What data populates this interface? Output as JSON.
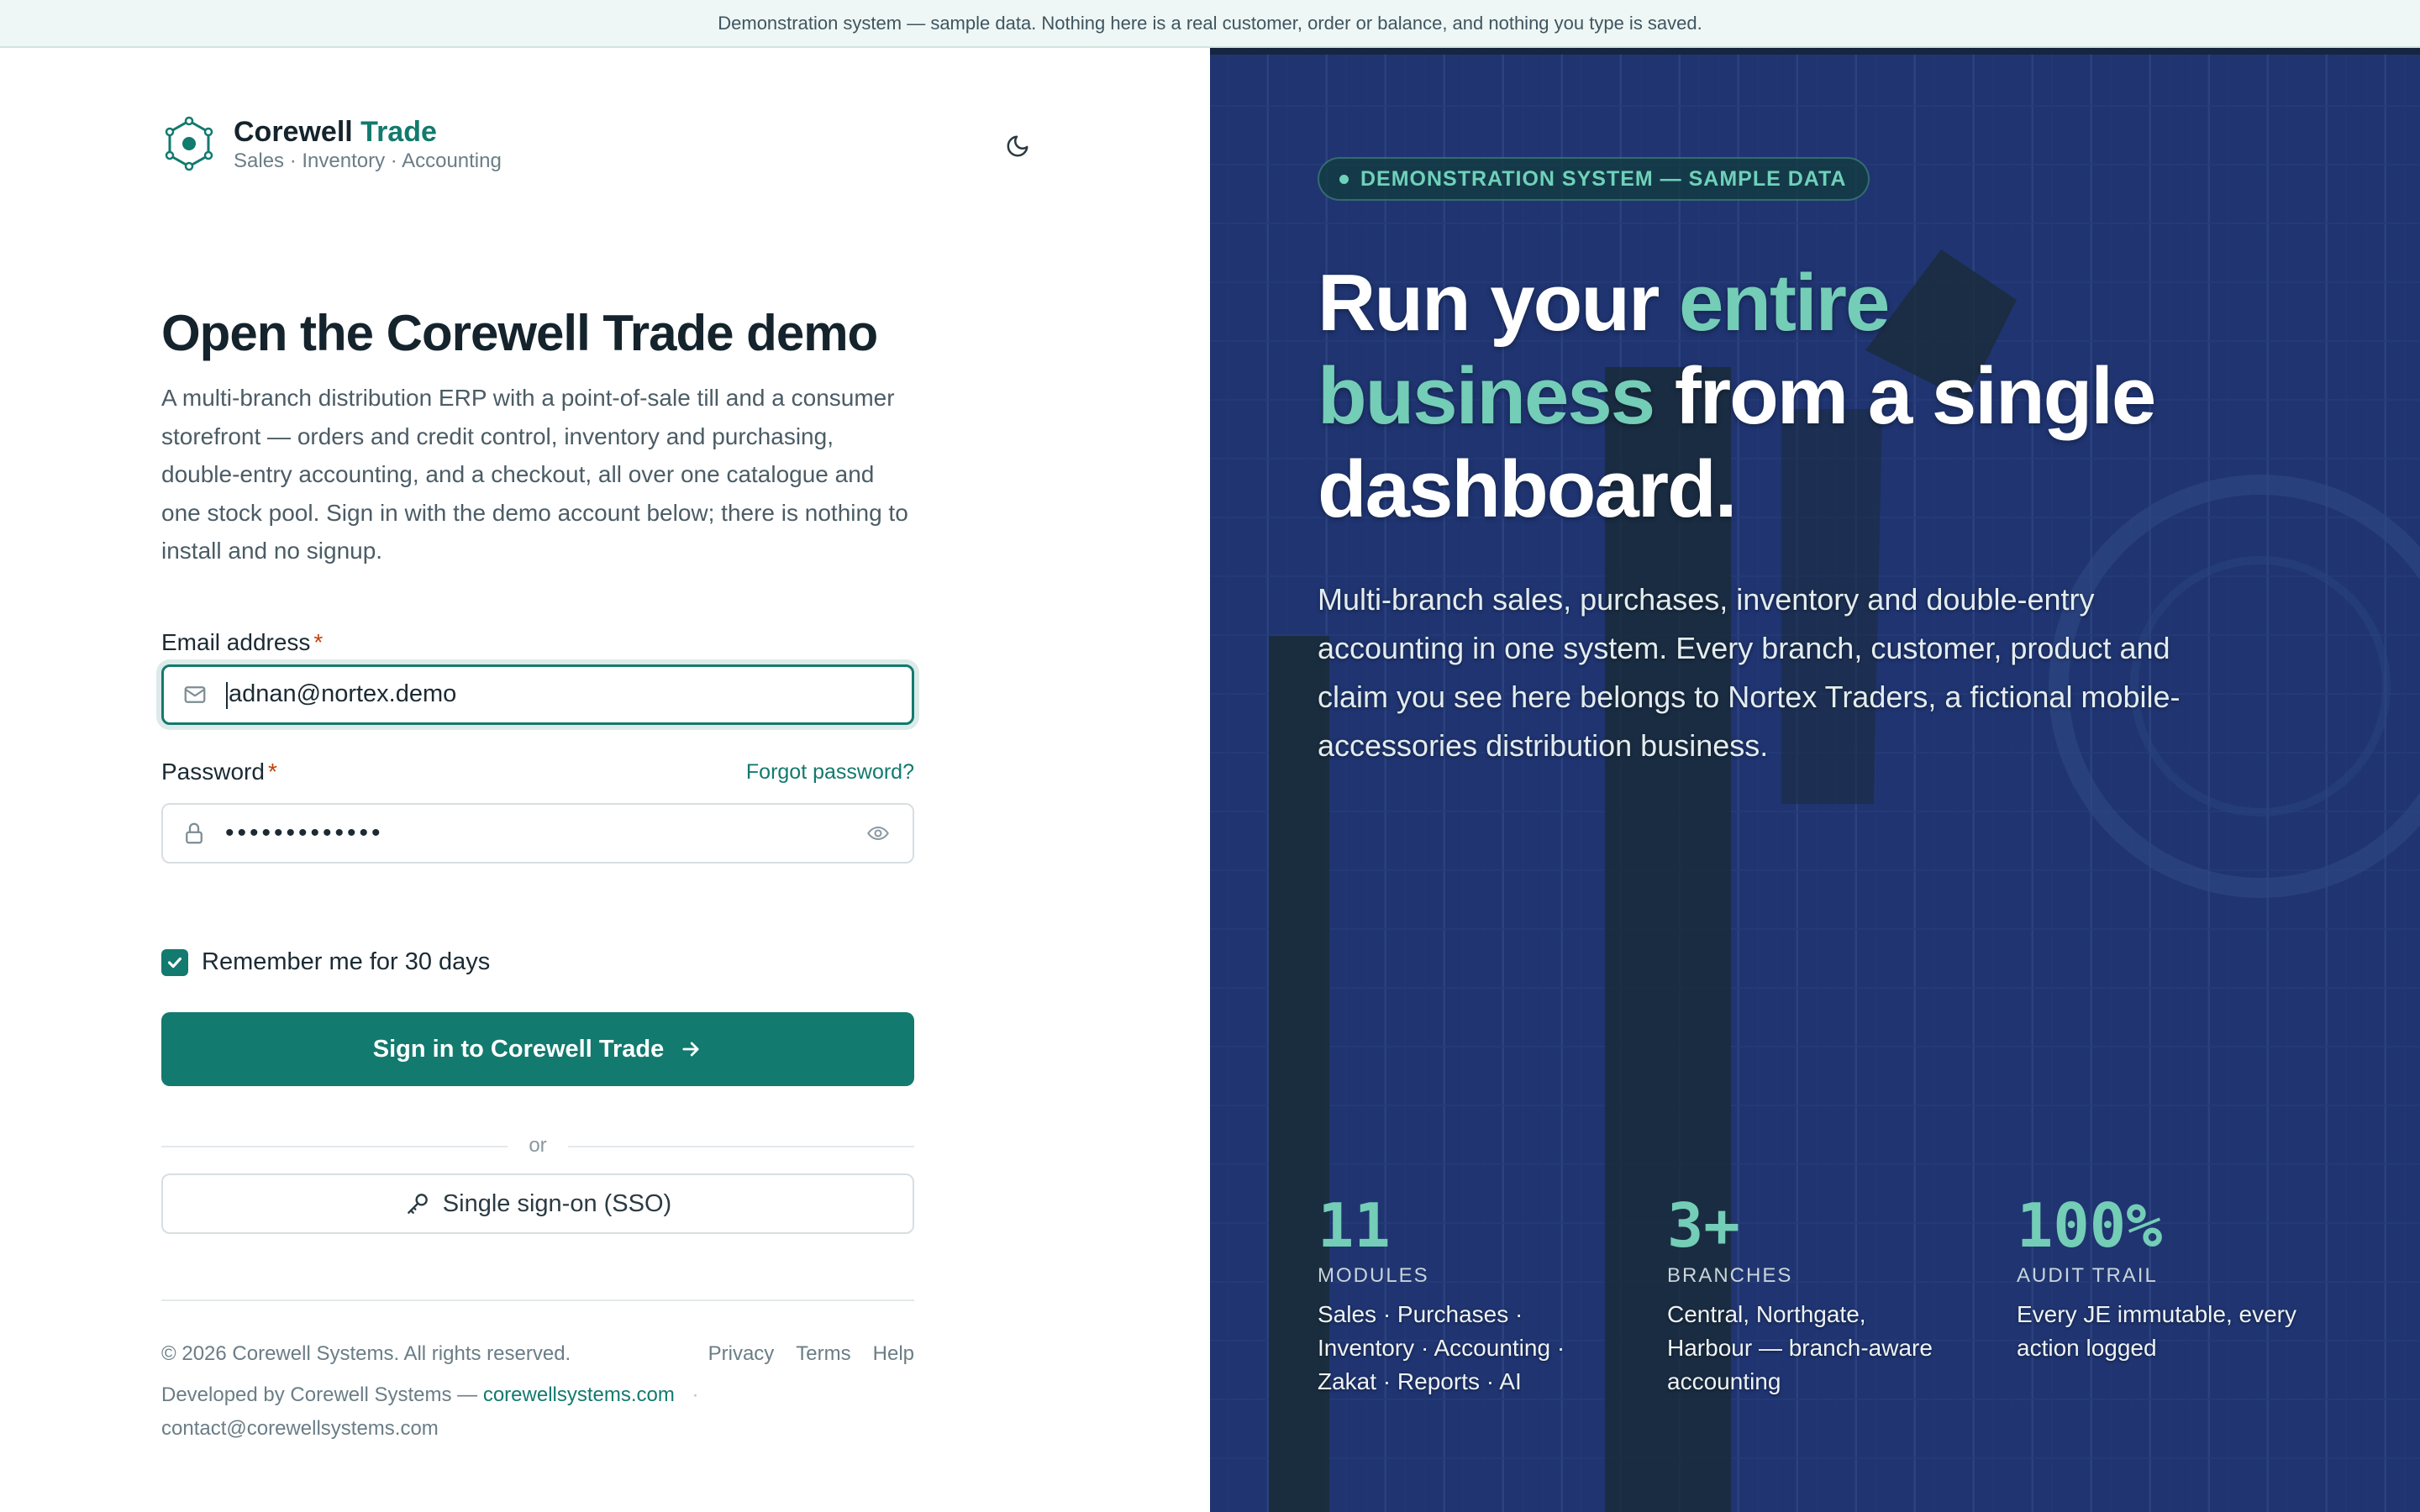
{
  "banner": {
    "text": "Demonstration system — sample data. Nothing here is a real customer, order or balance, and nothing you type is saved."
  },
  "brand": {
    "name": "Corewell",
    "name_accent": "Trade",
    "subtitle": "Sales · Inventory · Accounting"
  },
  "theme_toggle": {
    "icon": "moon-icon"
  },
  "login": {
    "title": "Open the Corewell Trade demo",
    "intro": "A multi-branch distribution ERP with a point-of-sale till and a consumer storefront — orders and credit control, inventory and purchasing, double-entry accounting, and a checkout, all over one catalogue and one stock pool. Sign in with the demo account below; there is nothing to install and no signup.",
    "email": {
      "label": "Email address",
      "required_mark": "*",
      "value": "adnan@nortex.demo",
      "icon": "mail-icon"
    },
    "password": {
      "label": "Password",
      "required_mark": "*",
      "value": "•••••••••••••",
      "icon": "lock-icon",
      "toggle_icon": "eye-icon"
    },
    "forgot_link": "Forgot password?",
    "remember": {
      "label": "Remember me for 30 days",
      "checked": true
    },
    "signin_button": "Sign in to Corewell Trade",
    "divider": "or",
    "sso_button": "Single sign-on (SSO)"
  },
  "footer": {
    "copyright": "© 2026 Corewell Systems. All rights reserved.",
    "links": [
      "Privacy",
      "Terms",
      "Help"
    ],
    "developed_by": "Developed by Corewell Systems —",
    "site_link": "corewellsystems.com",
    "separator": "·",
    "contact": "contact@corewellsystems.com"
  },
  "promo": {
    "badge": "DEMONSTRATION SYSTEM — SAMPLE DATA",
    "headline_1": "Run your ",
    "headline_hl": "entire business",
    "headline_2": " from a single dashboard.",
    "description": "Multi-branch sales, purchases, inventory and double-entry accounting in one system. Every branch, customer, product and claim you see here belongs to Nortex Traders, a fictional mobile-accessories distribution business.",
    "stats": [
      {
        "value": "11",
        "label": "MODULES",
        "desc": "Sales · Purchases · Inventory · Accounting · Zakat · Reports · AI"
      },
      {
        "value": "3+",
        "label": "BRANCHES",
        "desc": "Central, Northgate, Harbour — branch-aware accounting"
      },
      {
        "value": "100%",
        "label": "AUDIT TRAIL",
        "desc": "Every JE immutable, every action logged"
      }
    ]
  },
  "colors": {
    "accent": "#127a6e",
    "accent_light": "#74cdb6",
    "panel_bg": "#1f3470",
    "required": "#c2410c"
  }
}
